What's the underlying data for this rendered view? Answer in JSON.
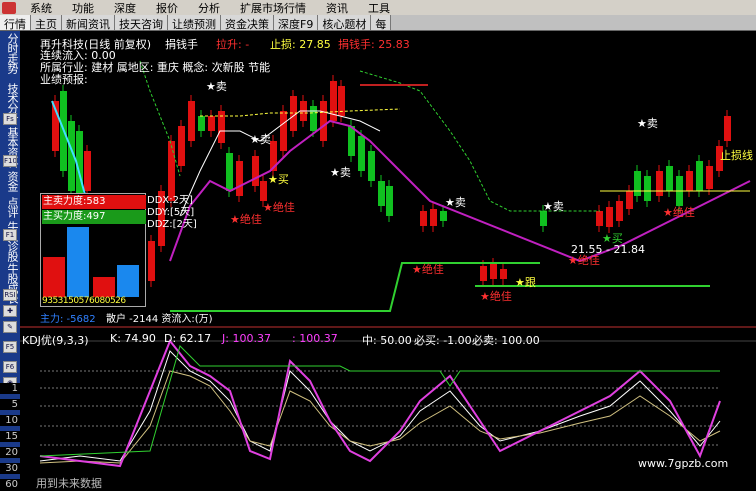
{
  "menubar": {
    "items": [
      "系统",
      "功能",
      "深度",
      "报价",
      "分析",
      "扩展市场行情",
      "资讯",
      "工具"
    ]
  },
  "tabs": [
    "行情",
    "主页",
    "新闻资讯",
    "技天咨询",
    "让绩预测",
    "资金决策",
    "深度F9",
    "核心题材",
    "每"
  ],
  "sidebar": {
    "groups": [
      "分时走势",
      "技术分析",
      "基本资料"
    ],
    "lower_groups": [
      "资金",
      "点评",
      "牛叉诊股",
      "牛股成长"
    ],
    "buttons": [
      "Fs",
      "F10",
      "F1",
      "RSI",
      "✚",
      "✎",
      "F5",
      "F6",
      "◉"
    ],
    "scale": [
      "1",
      "5",
      "10",
      "15",
      "20",
      "30",
      "60"
    ]
  },
  "header": {
    "title": "再升科技(日线 前复权)",
    "indicator_name": "捐钱手",
    "pull_up": "拉升: -",
    "stop_loss": "止损: 27.85",
    "money_hand": "捐钱手: 25.83",
    "inflow_label": "连续流入: 0.00",
    "industry": "所属行业: 建材 属地区: 重庆 概念: 次新股 节能",
    "performance": "业绩预报:"
  },
  "annotations": {
    "sell": "卖",
    "buy": "买",
    "best": "绝佳",
    "follow": "跟",
    "stop_loss_tag": "止损线"
  },
  "ddx_labels": [
    "DDX:2天]",
    "DDY:[5天]",
    "DDZ:[2天]"
  ],
  "panel": {
    "main_sell_label": "主卖力度:583",
    "main_buy_label": "主买力度:497",
    "numbers": "9353150576080526",
    "main_force": "主力: -5682",
    "retail": "散户 -2144 资流入:(万)"
  },
  "price_annotation": "21.55 - 21.84",
  "kdj": {
    "name": "KDJ优(9,3,3)",
    "k": "K: 74.90",
    "d": "D: 62.17",
    "j": "J: 100.37",
    "j2": ": 100.37",
    "mid": "中: 50.00",
    "must_buy": "必买: -1.00",
    "must_sell": "必卖: 100.00"
  },
  "footer": {
    "note": "用到未来数据",
    "watermark": "www.7gpzb.com"
  },
  "colors": {
    "up": "#e01010",
    "down": "#10c020",
    "ma": "#c020c0",
    "line_y": "#ffff40"
  }
}
